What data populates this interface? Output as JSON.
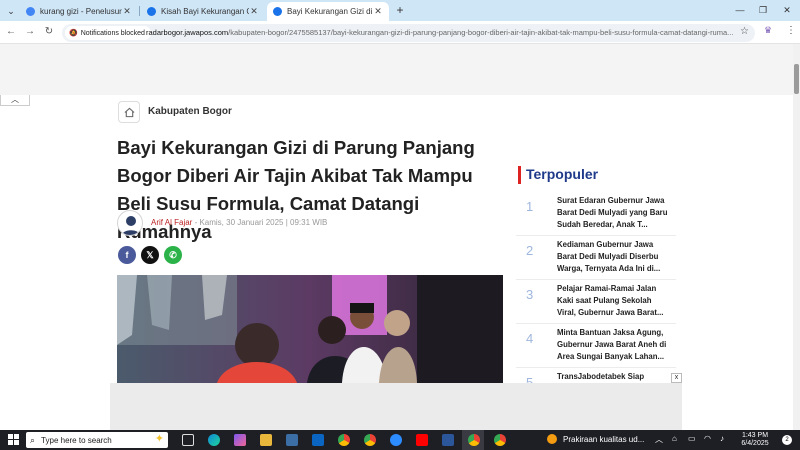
{
  "tabs": [
    {
      "title": "kurang gizi - Penelusuran Goog",
      "favicon_color": "#4285f4"
    },
    {
      "title": "Kisah Bayi Kekurangan Gizi di P",
      "favicon_color": "#1a73e8"
    },
    {
      "title": "Bayi Kekurangan Gizi di Parung",
      "favicon_color": "#1a73e8"
    }
  ],
  "toolbar": {
    "notifications_blocked": "Notifications blocked",
    "url_host": "radarbogor.jawapos.com",
    "url_path": "/kabupaten-bogor/2475585137/bayi-kekurangan-gizi-di-parung-panjang-bogor-diberi-air-tajin-akibat-tak-mampu-beli-susu-formula-camat-datangi-ruma..."
  },
  "breadcrumb": {
    "label": "Kabupaten Bogor"
  },
  "article": {
    "title": "Bayi Kekurangan Gizi di Parung Panjang Bogor Diberi Air Tajin Akibat Tak Mampu Beli Susu Formula, Camat Datangi Rumahnya",
    "author": "Arif Al Fajar",
    "date": " - Kamis, 30 Januari 2025 | 09:31 WIB"
  },
  "share": {
    "facebook": "f",
    "x": "𝕏",
    "whatsapp": "✆"
  },
  "sidebar": {
    "heading": "Terpopuler",
    "items": [
      {
        "num": "1",
        "text": "Surat Edaran Gubernur Jawa Barat Dedi Mulyadi yang Baru Sudah Beredar, Anak T..."
      },
      {
        "num": "2",
        "text": "Kediaman Gubernur Jawa Barat Dedi Mulyadi Diserbu Warga, Ternyata Ada Ini di..."
      },
      {
        "num": "3",
        "text": "Pelajar Ramai-Ramai Jalan Kaki saat Pulang Sekolah Viral, Gubernur Jawa Barat..."
      },
      {
        "num": "4",
        "text": "Minta Bantuan Jaksa Agung, Gubernur Jawa Barat Aneh di Area Sungai Banyak Lahan..."
      },
      {
        "num": "5",
        "text": "TransJabodetabek Siap"
      }
    ]
  },
  "ad": {
    "close": "x"
  },
  "taskbar": {
    "search_placeholder": "Type here to search",
    "weather": "Prakiraan kualitas ud...",
    "time": "1:43 PM",
    "date": "6/4/2025",
    "notifications": "2"
  },
  "colors": {
    "accent_red": "#dd2222",
    "title_blue": "#1f3a8a"
  }
}
